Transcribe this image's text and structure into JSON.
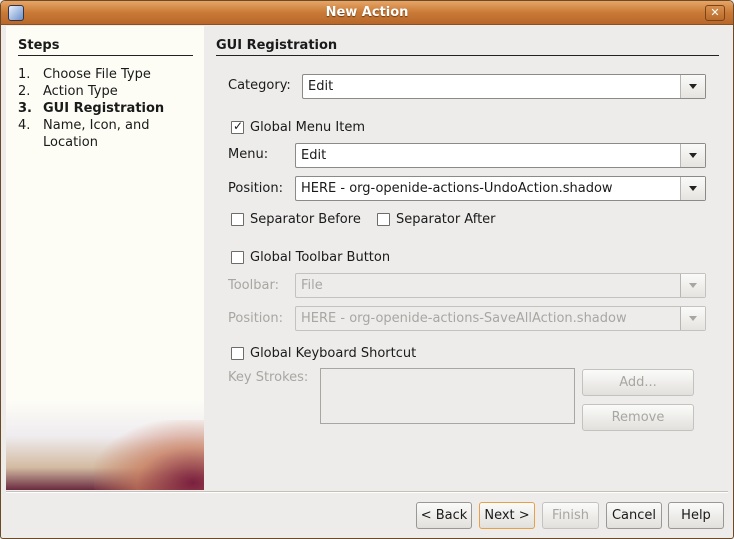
{
  "window": {
    "title": "New Action"
  },
  "steps": {
    "heading": "Steps",
    "items": [
      {
        "num": "1.",
        "label": "Choose File Type"
      },
      {
        "num": "2.",
        "label": "Action Type"
      },
      {
        "num": "3.",
        "label": "GUI Registration",
        "current": true
      },
      {
        "num": "4.",
        "label": "Name, Icon, and"
      },
      {
        "num": "",
        "label": "Location"
      }
    ]
  },
  "panel": {
    "heading": "GUI Registration",
    "category_label": "Category:",
    "category_value": "Edit",
    "global_menu_item": {
      "label": "Global Menu Item",
      "checked": true
    },
    "menu_label": "Menu:",
    "menu_value": "Edit",
    "position_label": "Position:",
    "position_value": "HERE - org-openide-actions-UndoAction.shadow",
    "separator_before": {
      "label": "Separator Before",
      "checked": false
    },
    "separator_after": {
      "label": "Separator After",
      "checked": false
    },
    "global_toolbar_button": {
      "label": "Global Toolbar Button",
      "checked": false
    },
    "toolbar_label": "Toolbar:",
    "toolbar_value": "File",
    "toolbar_position_label": "Position:",
    "toolbar_position_value": "HERE - org-openide-actions-SaveAllAction.shadow",
    "global_keyboard_shortcut": {
      "label": "Global Keyboard Shortcut",
      "checked": false
    },
    "key_strokes_label": "Key Strokes:",
    "add_label": "Add...",
    "remove_label": "Remove"
  },
  "footer": {
    "back": "< Back",
    "next": "Next >",
    "finish": "Finish",
    "cancel": "Cancel",
    "help": "Help"
  }
}
